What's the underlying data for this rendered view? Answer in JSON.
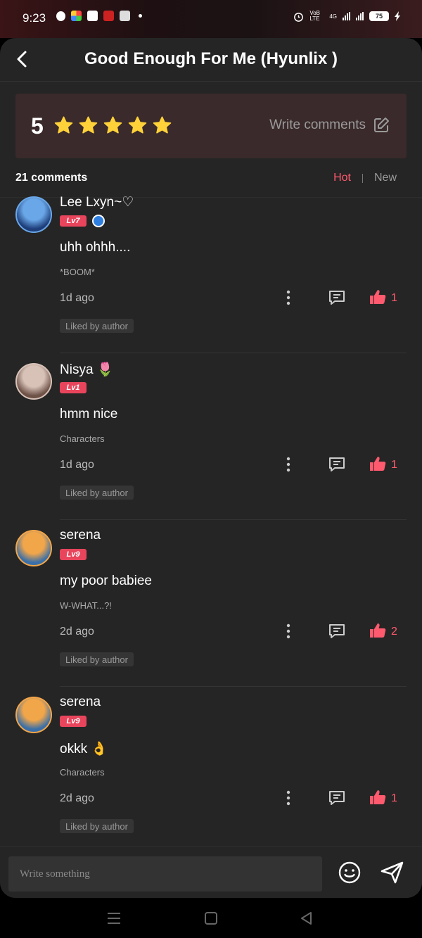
{
  "status_bar": {
    "time": "9:23",
    "network": "4G",
    "volte": "VoB LTE",
    "battery": "75"
  },
  "header": {
    "title": "Good Enough For Me (Hyunlix )"
  },
  "rating": {
    "score": "5",
    "stars": 5,
    "write_label": "Write comments"
  },
  "comments_section": {
    "count_label": "21 comments",
    "sort_hot": "Hot",
    "sort_new": "New",
    "active_sort": "Hot"
  },
  "comments": [
    {
      "username": "Lee Lxyn~♡",
      "level": "Lv7",
      "text": "uhh ohhh....",
      "subtext": "*BOOM*",
      "time": "1d ago",
      "likes": "1",
      "badge": "Liked by author",
      "avatar_colors": [
        "#6aa7e8",
        "#1e3e7a"
      ]
    },
    {
      "username": "Nisya 🌷",
      "level": "Lv1",
      "text": "hmm nice",
      "subtext": "Characters",
      "time": "1d ago",
      "likes": "1",
      "badge": "Liked by author",
      "avatar_colors": [
        "#d8c2b8",
        "#6e5248"
      ]
    },
    {
      "username": "serena",
      "level": "Lv9",
      "text": "my poor babiee",
      "subtext": "W-WHAT...?!",
      "time": "2d ago",
      "likes": "2",
      "badge": "Liked by author",
      "avatar_colors": [
        "#f2a64a",
        "#3a6fa8"
      ]
    },
    {
      "username": "serena",
      "level": "Lv9",
      "text": "okkk 👌",
      "subtext": "Characters",
      "time": "2d ago",
      "likes": "1",
      "badge": "Liked by author",
      "avatar_colors": [
        "#f2a64a",
        "#3a6fa8"
      ]
    }
  ],
  "composer": {
    "placeholder": "Write something"
  },
  "colors": {
    "accent": "#ff5a6e",
    "star": "#ffd23a",
    "background": "#252525",
    "rating_box": "#3a2a2b"
  }
}
